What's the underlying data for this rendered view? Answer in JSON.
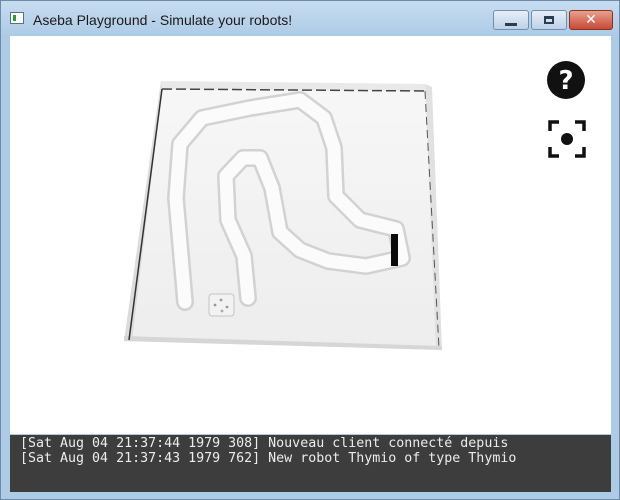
{
  "window": {
    "title": "Aseba Playground - Simulate your robots!",
    "controls": {
      "minimize": "minimize",
      "maximize": "maximize",
      "close": "close"
    }
  },
  "toolbar": {
    "help_icon": "help-icon",
    "focus_icon": "focus-icon"
  },
  "console": {
    "lines": [
      "[Sat Aug 04 21:37:44 1979 308] Nouveau client connecté depuis",
      "[Sat Aug 04 21:37:43 1979 762] New robot Thymio of type Thymio"
    ]
  },
  "colors": {
    "titlebar": "#aecbe6",
    "console_bg": "#3d3d3d",
    "console_text": "#ececec",
    "icon": "#111111"
  }
}
